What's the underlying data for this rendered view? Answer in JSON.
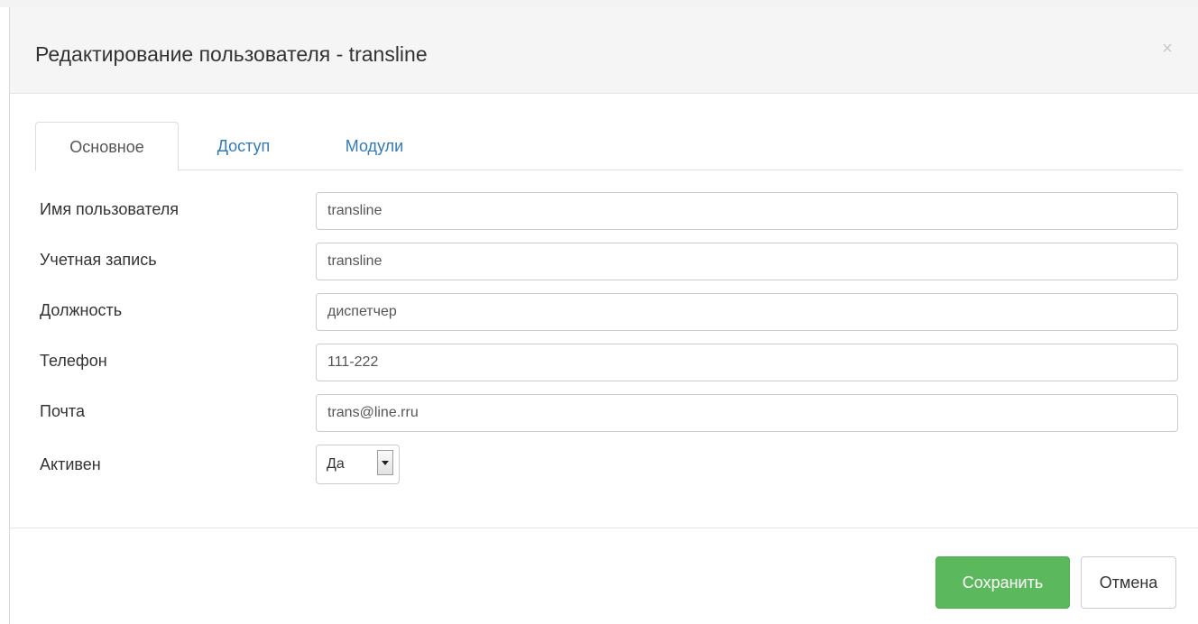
{
  "modal": {
    "title": "Редактирование пользователя - transline",
    "close_glyph": "×",
    "close_icon": "close-icon"
  },
  "tabs": [
    {
      "label": "Основное",
      "active": true
    },
    {
      "label": "Доступ",
      "active": false
    },
    {
      "label": "Модули",
      "active": false
    }
  ],
  "form": {
    "username": {
      "label": "Имя пользователя",
      "value": "transline"
    },
    "account": {
      "label": "Учетная запись",
      "value": "transline"
    },
    "position": {
      "label": "Должность",
      "value": "диспетчер"
    },
    "phone": {
      "label": "Телефон",
      "value": "111-222"
    },
    "email": {
      "label": "Почта",
      "value": "trans@line.rru"
    },
    "active": {
      "label": "Активен",
      "value": "Да",
      "icon": "chevron-down-icon"
    }
  },
  "footer": {
    "save_label": "Сохранить",
    "cancel_label": "Отмена"
  },
  "colors": {
    "save_button": "#5cb85c",
    "tab_link": "#337ab7",
    "header_background": "#f5f5f5"
  }
}
